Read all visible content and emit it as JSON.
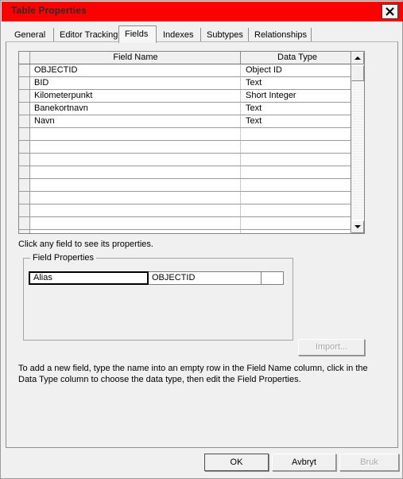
{
  "window": {
    "title": "Table Properties",
    "close_label": "✕",
    "titlebar_color": "#ff0000"
  },
  "tabs": [
    {
      "label": "General",
      "selected": false
    },
    {
      "label": "Editor Tracking",
      "selected": false
    },
    {
      "label": "Fields",
      "selected": true
    },
    {
      "label": "Indexes",
      "selected": false
    },
    {
      "label": "Subtypes",
      "selected": false
    },
    {
      "label": "Relationships",
      "selected": false
    }
  ],
  "grid": {
    "columns": [
      "Field Name",
      "Data Type"
    ],
    "rows": [
      {
        "name": "OBJECTID",
        "type": "Object ID"
      },
      {
        "name": "BID",
        "type": "Text"
      },
      {
        "name": "Kilometerpunkt",
        "type": "Short Integer"
      },
      {
        "name": "Banekortnavn",
        "type": "Text"
      },
      {
        "name": "Navn",
        "type": "Text"
      },
      {
        "name": "",
        "type": ""
      },
      {
        "name": "",
        "type": ""
      },
      {
        "name": "",
        "type": ""
      },
      {
        "name": "",
        "type": ""
      },
      {
        "name": "",
        "type": ""
      },
      {
        "name": "",
        "type": ""
      },
      {
        "name": "",
        "type": ""
      },
      {
        "name": "",
        "type": ""
      },
      {
        "name": "",
        "type": ""
      }
    ],
    "scrollbar": {
      "up_icon": "arrow-up-icon",
      "down_icon": "arrow-down-icon"
    }
  },
  "hint": "Click any field to see its properties.",
  "field_properties": {
    "group_title": "Field Properties",
    "rows": [
      {
        "key": "Alias",
        "value": "OBJECTID"
      }
    ],
    "import_label": "Import...",
    "import_disabled": true
  },
  "instructions": "To add a new field, type the name into an empty row in the Field Name column, click in the Data Type column to choose the data type, then edit the Field Properties.",
  "footer": {
    "ok_label": "OK",
    "cancel_label": "Avbryt",
    "apply_label": "Bruk",
    "apply_disabled": true
  }
}
